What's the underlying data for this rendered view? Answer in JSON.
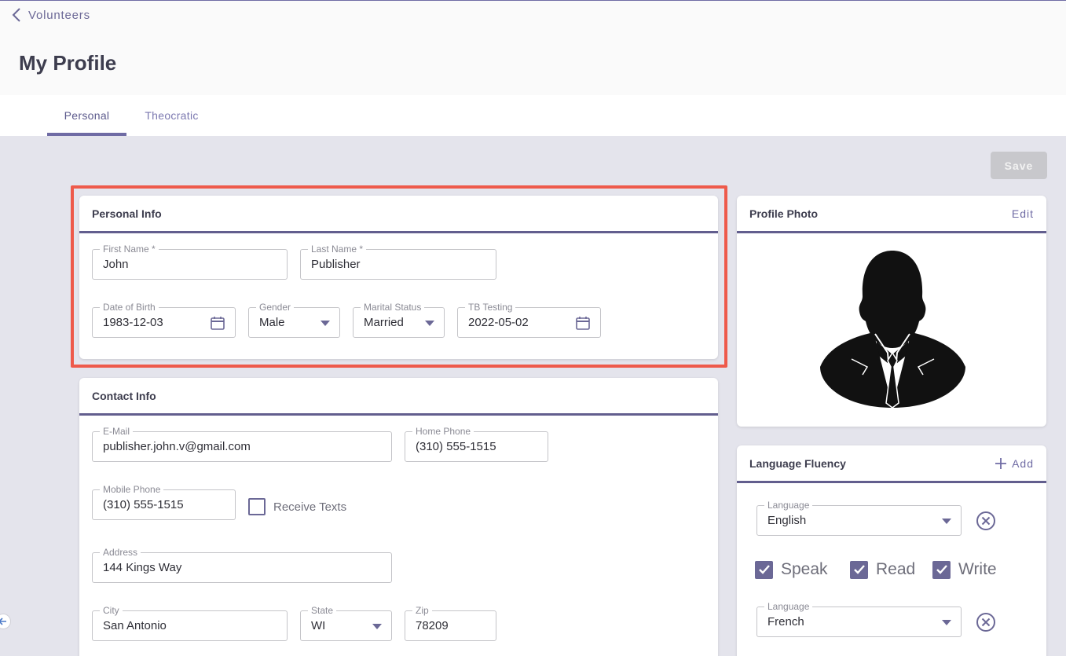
{
  "nav": {
    "back_label": "Volunteers"
  },
  "page": {
    "title": "My Profile"
  },
  "tabs": [
    {
      "label": "Personal"
    },
    {
      "label": "Theocratic"
    }
  ],
  "toolbar": {
    "save_label": "Save"
  },
  "personal": {
    "title": "Personal Info",
    "first_name": {
      "label": "First Name *",
      "value": "John"
    },
    "last_name": {
      "label": "Last Name *",
      "value": "Publisher"
    },
    "dob": {
      "label": "Date of Birth",
      "value": "1983-12-03"
    },
    "gender": {
      "label": "Gender",
      "value": "Male"
    },
    "marital": {
      "label": "Marital Status",
      "value": "Married"
    },
    "tb": {
      "label": "TB Testing",
      "value": "2022-05-02"
    }
  },
  "contact": {
    "title": "Contact Info",
    "email": {
      "label": "E-Mail",
      "value": "publisher.john.v@gmail.com"
    },
    "home_phone": {
      "label": "Home Phone",
      "value": "(310) 555-1515"
    },
    "mobile_phone": {
      "label": "Mobile Phone",
      "value": "(310) 555-1515"
    },
    "receive_texts": "Receive Texts",
    "address": {
      "label": "Address",
      "value": "144 Kings Way"
    },
    "city": {
      "label": "City",
      "value": "San Antonio"
    },
    "state": {
      "label": "State",
      "value": "WI"
    },
    "zip": {
      "label": "Zip",
      "value": "78209"
    }
  },
  "photo": {
    "title": "Profile Photo",
    "edit_label": "Edit"
  },
  "languages": {
    "title": "Language Fluency",
    "add_label": "Add",
    "items": [
      {
        "label": "Language",
        "value": "English",
        "speak": "Speak",
        "read": "Read",
        "write": "Write"
      },
      {
        "label": "Language",
        "value": "French"
      }
    ]
  },
  "colors": {
    "accent": "#6f6ba4",
    "highlight": "#ee5a4b"
  }
}
